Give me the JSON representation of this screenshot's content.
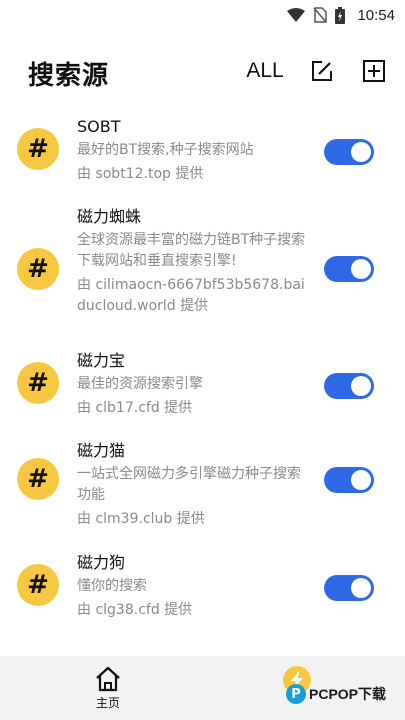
{
  "status_bar": {
    "time": "10:54"
  },
  "header": {
    "title": "搜索源",
    "all_label": "ALL"
  },
  "sources": [
    {
      "name": "SOBT",
      "desc": "最好的BT搜索,种子搜索网站",
      "provider": "由 sobt12.top 提供",
      "enabled": true
    },
    {
      "name": "磁力蜘蛛",
      "desc": "全球资源最丰富的磁力链BT种子搜索下载网站和垂直搜索引擎!",
      "provider": "由 cilimaocn-6667bf53b5678.baiducloud.world 提供",
      "enabled": true
    },
    {
      "name": "磁力宝",
      "desc": "最佳的资源搜索引擎",
      "provider": "由 clb17.cfd 提供",
      "enabled": true
    },
    {
      "name": "磁力猫",
      "desc": "一站式全网磁力多引擎磁力种子搜索功能",
      "provider": "由 clm39.club 提供",
      "enabled": true
    },
    {
      "name": "磁力狗",
      "desc": "懂你的搜索",
      "provider": "由 clg38.cfd 提供",
      "enabled": true
    }
  ],
  "avatar_glyph": "#",
  "bottom_nav": {
    "home_label": "主页"
  },
  "watermark": {
    "logo": "P",
    "text": "PCPOP下载"
  },
  "colors": {
    "accent": "#2f6ae6",
    "avatar": "#f6c842",
    "nav_bg": "#f2f2f2"
  }
}
